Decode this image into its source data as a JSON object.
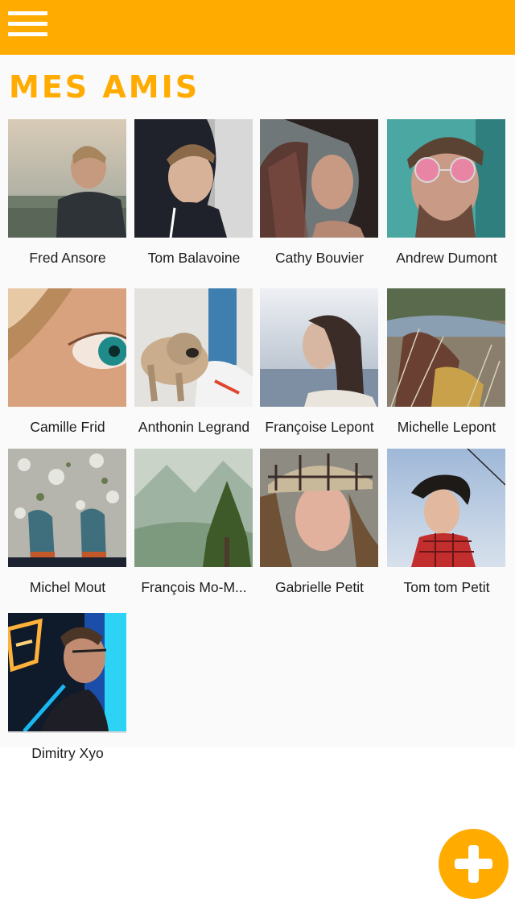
{
  "header": {
    "menu_icon": "hamburger-menu-icon",
    "background": "#ffab00"
  },
  "page": {
    "title": "MES AMIS",
    "accent": "#ffab00"
  },
  "friends": [
    {
      "name": "Fred Ansore"
    },
    {
      "name": "Tom Balavoine"
    },
    {
      "name": "Cathy Bouvier"
    },
    {
      "name": "Andrew Dumont"
    },
    {
      "name": "Camille Frid"
    },
    {
      "name": "Anthonin Legrand"
    },
    {
      "name": "Françoise Lepont"
    },
    {
      "name": "Michelle Lepont"
    },
    {
      "name": "Michel Mout"
    },
    {
      "name": "François Mo-M..."
    },
    {
      "name": "Gabrielle Petit"
    },
    {
      "name": "Tom tom Petit"
    },
    {
      "name": "Dimitry Xyo"
    }
  ],
  "fab": {
    "icon": "plus-icon"
  }
}
